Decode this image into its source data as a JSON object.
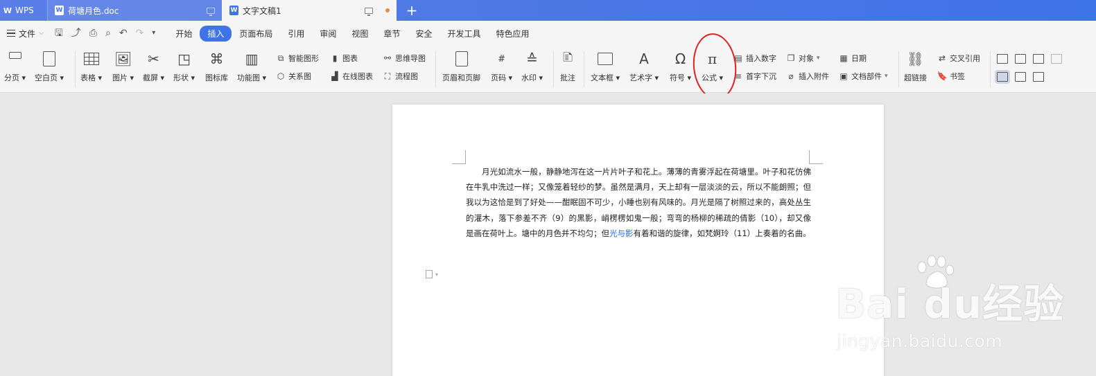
{
  "titlebar": {
    "app_label": "WPS",
    "tabs": [
      {
        "title": "荷塘月色.doc",
        "active": false
      },
      {
        "title": "文字文稿1",
        "active": true
      }
    ],
    "new_tab": "+"
  },
  "menubar": {
    "file_label": "文件",
    "items": [
      "开始",
      "插入",
      "页面布局",
      "引用",
      "审阅",
      "视图",
      "章节",
      "安全",
      "开发工具",
      "特色应用"
    ],
    "active_item": "插入"
  },
  "ribbon": {
    "page_break": "分页",
    "blank_page": "空白页",
    "table": "表格",
    "picture": "图片",
    "screenshot": "截屏",
    "shape": "形状",
    "icon_library": "图标库",
    "function_chart": "功能图",
    "smart_art": "智能图形",
    "relation_chart": "关系图",
    "chart": "图表",
    "online_chart": "在线图表",
    "mind_map": "思维导图",
    "flowchart": "流程图",
    "header_footer": "页眉和页脚",
    "page_number": "页码",
    "watermark": "水印",
    "comment": "批注",
    "textbox": "文本框",
    "wordart": "艺术字",
    "symbol": "符号",
    "formula": "公式",
    "insert_number": "插入数字",
    "drop_cap": "首字下沉",
    "object": "对象",
    "attachment": "插入附件",
    "date": "日期",
    "doc_parts": "文档部件",
    "hyperlink": "超链接",
    "cross_ref": "交叉引用",
    "bookmark": "书签"
  },
  "document": {
    "paragraph_before": "月光如流水一般，静静地泻在这一片片叶子和花上。薄薄的青雾浮起在荷塘里。叶子和花仿佛在牛乳中洗过一样；又像笼着轻纱的梦。虽然是满月，天上却有一层淡淡的云，所以不能朗照；但我以为这恰是到了好处——酣眠固不可少，小睡也别有风味的。月光是隔了树照过来的，高处丛生的灌木，落下参差不齐（9）的黑影，峭楞楞如鬼一般；弯弯的杨柳的稀疏的倩影（10），却又像是画在荷叶上。塘中的月色并不均匀；但",
    "paragraph_link": "光与影",
    "paragraph_after": "有着和谐的旋律，如梵婀玲（11）上奏着的名曲。"
  },
  "watermark": {
    "brand": "Bai  du经验",
    "url": "jingyan.baidu.com"
  }
}
